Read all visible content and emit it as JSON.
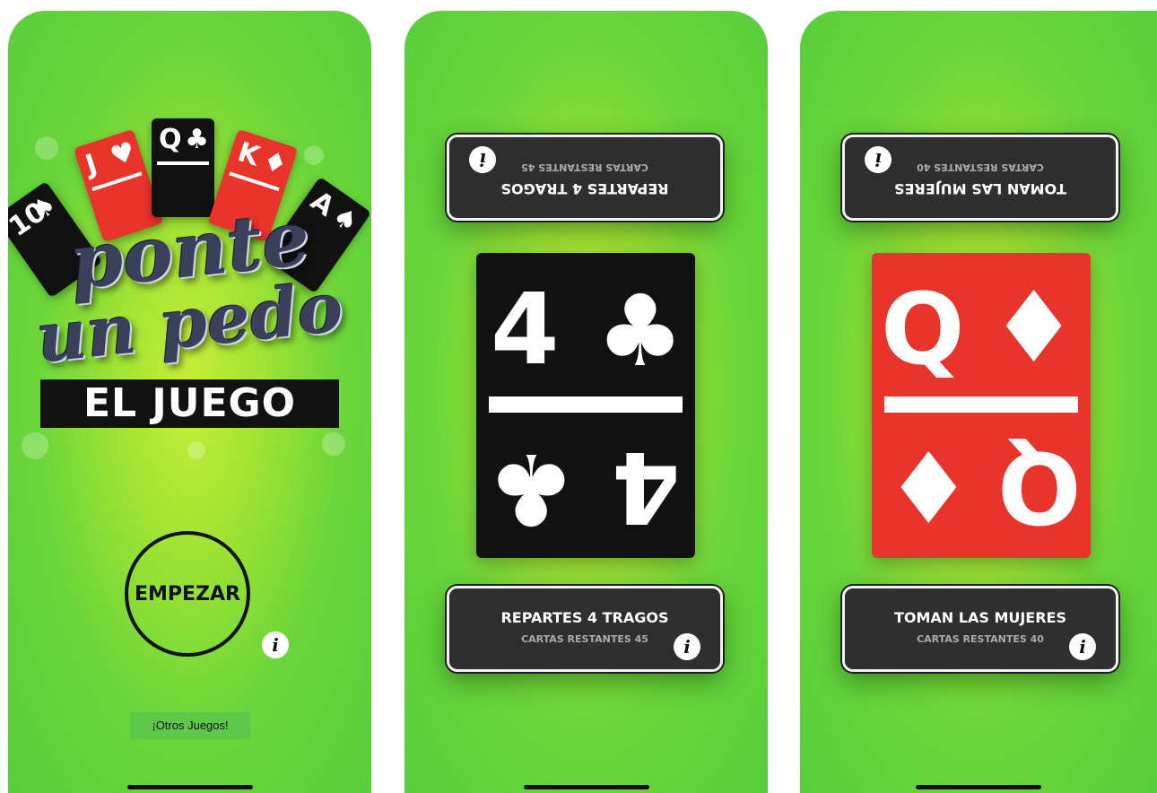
{
  "home": {
    "cards": [
      {
        "rank": "10",
        "suit": "♠",
        "color": "#111111"
      },
      {
        "rank": "J",
        "suit": "♥",
        "color": "#e8342a"
      },
      {
        "rank": "Q",
        "suit": "♣",
        "color": "#111111"
      },
      {
        "rank": "K",
        "suit": "♦",
        "color": "#e8342a"
      },
      {
        "rank": "A",
        "suit": "♠",
        "color": "#111111"
      }
    ],
    "logo_line1": "ponte",
    "logo_line2": "un pedo",
    "title": "EL JUEGO",
    "start_label": "EMPEZAR",
    "info_icon": "i",
    "other_games_label": "¡Otros Juegos!"
  },
  "screen2": {
    "card": {
      "rank": "4",
      "suit": "♣",
      "color": "#111111"
    },
    "rule": "REPARTES 4 TRAGOS",
    "remaining": "CARTAS RESTANTES 45",
    "info_icon": "i"
  },
  "screen3": {
    "card": {
      "rank": "Q",
      "suit": "♦",
      "color": "#e8342a"
    },
    "rule": "TOMAN LAS MUJERES",
    "remaining": "CARTAS RESTANTES 40",
    "info_icon": "i"
  },
  "colors": {
    "background_green": "#5fd13c",
    "center_glow": "#c8ee3a",
    "panel": "#2e2e2e",
    "red_card": "#e8342a",
    "black_card": "#111111"
  }
}
